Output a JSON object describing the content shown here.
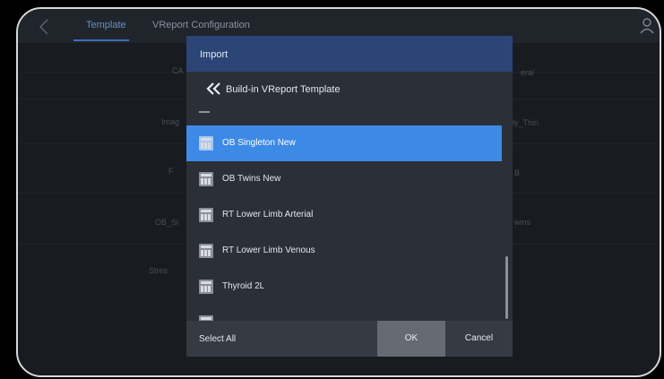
{
  "tabs": {
    "template": "Template",
    "vreport_config": "VReport Configuration"
  },
  "background_labels": [
    "CA",
    "Imag",
    "F",
    "OB_Si",
    "Stres",
    "eral",
    "ly_Thin",
    "B",
    "wins"
  ],
  "dialog": {
    "title": "Import",
    "breadcrumb": "Build-in VReport Template",
    "items": [
      {
        "label": "OB Singleton New",
        "selected": true
      },
      {
        "label": "OB Twins New",
        "selected": false
      },
      {
        "label": "RT Lower Limb Arterial",
        "selected": false
      },
      {
        "label": "RT Lower Limb Venous",
        "selected": false
      },
      {
        "label": "Thyroid 2L",
        "selected": false
      },
      {
        "label": "",
        "selected": false
      }
    ],
    "select_all": "Select All",
    "ok": "OK",
    "cancel": "Cancel"
  },
  "colors": {
    "selected": "#3c8ae6",
    "header": "#2c4577",
    "tab_active": "#6a8fc9"
  }
}
